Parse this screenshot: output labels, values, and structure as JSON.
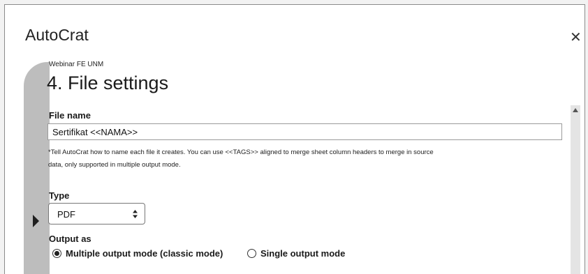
{
  "app": {
    "title": "AutoCrat"
  },
  "header": {
    "subtitle": "Webinar FE UNM",
    "title": "4. File settings"
  },
  "file_name": {
    "label": "File name",
    "value": "Sertifikat <<NAMA>>",
    "help_line1": "*Tell AutoCrat how to name each file it creates. You can use <<TAGS>> aligned to merge sheet column headers to merge in source",
    "help_line2": "data, only supported in multiple output mode."
  },
  "type": {
    "label": "Type",
    "selected": "PDF"
  },
  "output": {
    "label": "Output as",
    "options": [
      {
        "label": "Multiple output mode (classic mode)",
        "checked": true
      },
      {
        "label": "Single output mode",
        "checked": false
      }
    ]
  },
  "icons": {
    "close": "close-icon",
    "rail": "caret-right-icon",
    "scroll_up": "scroll-up-icon",
    "select_arrows": "select-arrows-icon"
  }
}
